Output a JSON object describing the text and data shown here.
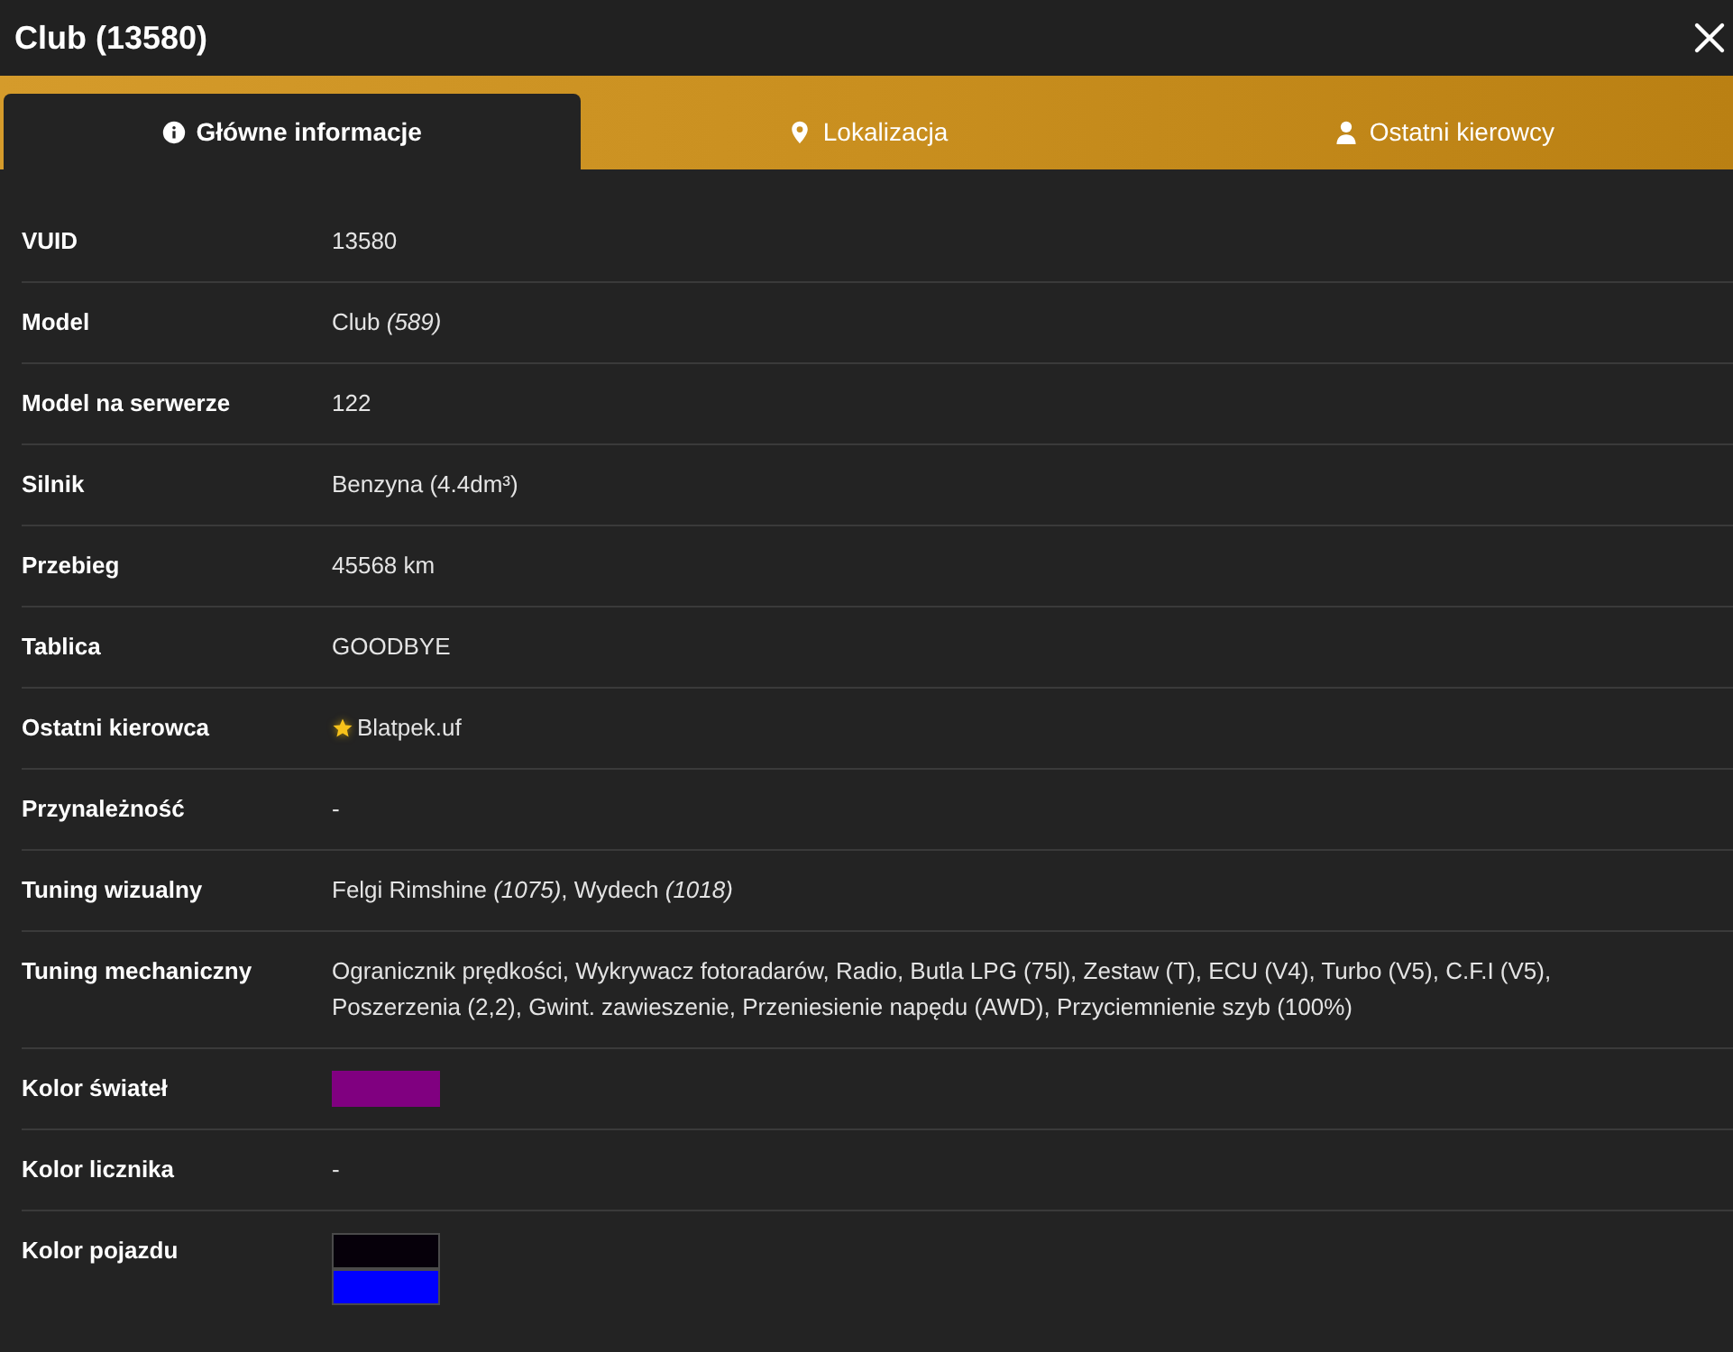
{
  "window": {
    "title": "Club (13580)"
  },
  "tabs": [
    {
      "label": "Główne informacje",
      "selected": true
    },
    {
      "label": "Lokalizacja",
      "selected": false
    },
    {
      "label": "Ostatni kierowcy",
      "selected": false
    }
  ],
  "rows": [
    {
      "kind": "text",
      "label": "VUID",
      "value": "13580"
    },
    {
      "kind": "text",
      "label": "Model",
      "value": "Club *(589)*"
    },
    {
      "kind": "text",
      "label": "Model na serwerze",
      "value": "122"
    },
    {
      "kind": "text",
      "label": "Silnik",
      "value": "Benzyna (4.4dm³)"
    },
    {
      "kind": "text",
      "label": "Przebieg",
      "value": "45568 km"
    },
    {
      "kind": "text",
      "label": "Tablica",
      "value": "GOODBYE"
    },
    {
      "kind": "driver",
      "label": "Ostatni kierowca",
      "value": "Blatpek.uf",
      "starred": true
    },
    {
      "kind": "text",
      "label": "Przynależność",
      "value": "-"
    },
    {
      "kind": "text",
      "label": "Tuning wizualny",
      "value": "Felgi Rimshine *(1075)*, Wydech *(1018)*"
    },
    {
      "kind": "text",
      "label": "Tuning mechaniczny",
      "value": "Ogranicznik prędkości, Wykrywacz fotoradarów, Radio, Butla LPG (75l), Zestaw (T), ECU (V4), Turbo (V5), C.F.I (V5), Poszerzenia (2,2), Gwint. zawieszenie, Przeniesienie napędu (AWD), Przyciemnienie szyb (100%)"
    },
    {
      "kind": "swatches",
      "label": "Kolor świateł",
      "swatches": [
        {
          "color": "#800080"
        }
      ]
    },
    {
      "kind": "text",
      "label": "Kolor licznika",
      "value": "-"
    },
    {
      "kind": "swatches",
      "label": "Kolor pojazdu",
      "swatches": [
        {
          "color": "#06000a"
        },
        {
          "color": "#0000ff"
        }
      ]
    }
  ]
}
